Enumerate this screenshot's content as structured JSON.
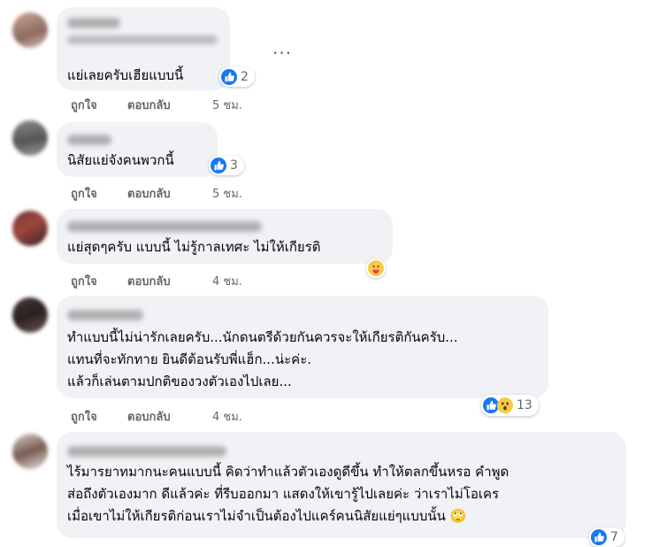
{
  "action_labels": {
    "like": "ถูกใจ",
    "reply": "ตอบกลับ"
  },
  "more_options": "...",
  "comments": [
    {
      "text_lines": [
        "แย่เลยครับเฮียแบบนี้"
      ],
      "reaction_count": "2",
      "reactions": [
        "like-icon"
      ],
      "time": "5 ชม."
    },
    {
      "text_lines": [
        "นิสัยแย่จังคนพวกนี้"
      ],
      "reaction_count": "3",
      "reactions": [
        "like-icon"
      ],
      "time": "5 ชม."
    },
    {
      "text_lines": [
        "แย่สุดๆครับ แบบนี้ ไม่รู้กาลเทศะ ไม่ให้เกียรติ"
      ],
      "reaction_count": "",
      "reactions": [
        "care-icon"
      ],
      "time": "4 ชม."
    },
    {
      "text_lines": [
        "ทำแบบนี้ไม่น่ารักเลยครับ...นักดนตรีด้วยกันควรจะให้เกียรติกันครับ...",
        "แทนที่จะทักทาย ยินดีต้อนรับพี่แฮ็ก...น่ะค่ะ.",
        "แล้วก็เล่นตามปกติของวงตัวเองไปเลย..."
      ],
      "reaction_count": "13",
      "reactions": [
        "like-icon",
        "wow-icon"
      ],
      "time": "4 ชม."
    },
    {
      "text_lines": [
        "ไร้มารยาทมากนะคนแบบนี้ คิดว่าทำแล้วตัวเองดูดีขึ้น ทำให้ตลกขึ้นหรอ คำพูด",
        "ส่อถึงตัวเองมาก ดีแล้วค่ะ ที่รีบออกมา แสดงให้เขารู้ไปเลยค่ะ ว่าเราไม่โอเคร",
        "เมื่อเขาไม่ให้เกียรติก่อนเราไม่จำเป็นต้องไปแคร์คนนิสัยแย่ๆแบบนั้น 🙄"
      ],
      "reaction_count": "7",
      "reactions": [
        "like-icon"
      ],
      "time": ""
    }
  ]
}
